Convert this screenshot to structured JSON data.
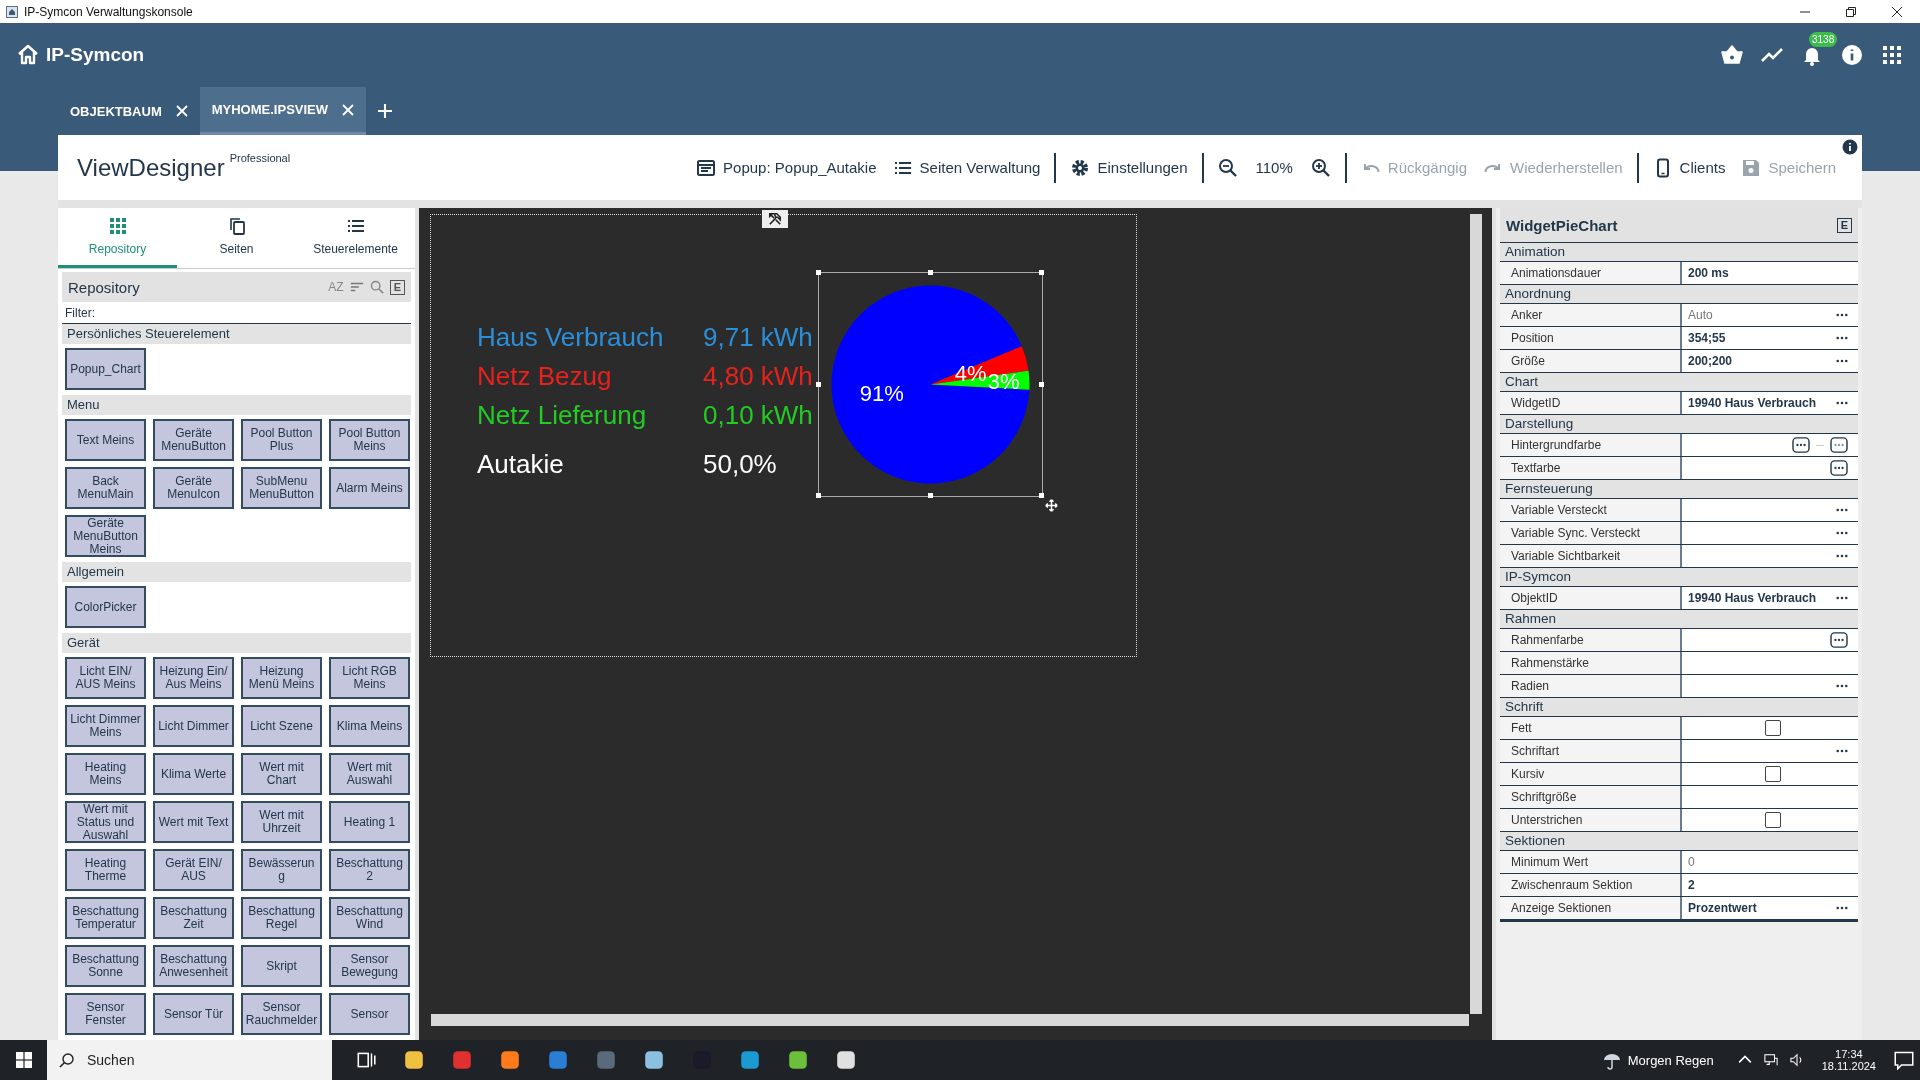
{
  "window": {
    "title": "IP-Symcon Verwaltungskonsole"
  },
  "header": {
    "brand": "IP-Symcon",
    "notification_count": "3138"
  },
  "tabs": [
    {
      "label": "OBJEKTBAUM",
      "selected": false
    },
    {
      "label": "MYHOME.IPSVIEW",
      "selected": true
    }
  ],
  "designer": {
    "title": "ViewDesigner",
    "edition": "Professional"
  },
  "toolbar": [
    {
      "kind": "popup",
      "label": "Popup: Popup_Autakie",
      "disabled": false
    },
    {
      "kind": "pages",
      "label": "Seiten Verwaltung",
      "disabled": false
    },
    {
      "kind": "divider"
    },
    {
      "kind": "settings",
      "label": "Einstellungen",
      "disabled": false
    },
    {
      "kind": "divider"
    },
    {
      "kind": "zoom_out",
      "disabled": false
    },
    {
      "kind": "zoom_level",
      "label": "110%",
      "disabled": false
    },
    {
      "kind": "zoom_in",
      "disabled": false
    },
    {
      "kind": "divider"
    },
    {
      "kind": "undo",
      "label": "Rückgängig",
      "disabled": true
    },
    {
      "kind": "redo",
      "label": "Wiederherstellen",
      "disabled": true
    },
    {
      "kind": "divider"
    },
    {
      "kind": "clients",
      "label": "Clients",
      "disabled": false
    },
    {
      "kind": "save",
      "label": "Speichern",
      "disabled": true
    }
  ],
  "left_tabs": [
    {
      "label": "Repository",
      "selected": true
    },
    {
      "label": "Seiten",
      "selected": false
    },
    {
      "label": "Steuerelemente",
      "selected": false
    }
  ],
  "repository": {
    "title": "Repository",
    "sort_label": "AZ",
    "badge": "E",
    "filter_label": "Filter:",
    "groups": [
      {
        "title": "Persönliches Steuerelement",
        "items": [
          "Popup_Chart"
        ]
      },
      {
        "title": "Menu",
        "items": [
          "Text Meins",
          "Geräte MenuButton",
          "Pool Button Plus",
          "Pool Button Meins",
          "Back MenuMain",
          "Geräte MenuIcon",
          "SubMenu MenuButton",
          "Alarm Meins",
          "Geräte MenuButton Meins"
        ]
      },
      {
        "title": "Allgemein",
        "items": [
          "ColorPicker"
        ]
      },
      {
        "title": "Gerät",
        "items": [
          "Licht EIN/ AUS Meins",
          "Heizung Ein/ Aus Meins",
          "Heizung Menü Meins",
          "Licht RGB Meins",
          "Licht Dimmer Meins",
          "Licht Dimmer",
          "Licht Szene",
          "Klima Meins",
          "Heating Meins",
          "Klima Werte",
          "Wert mit Chart",
          "Wert mit Auswahl",
          "Wert mit Status und Auswahl",
          "Wert mit Text",
          "Wert mit Uhrzeit",
          "Heating 1",
          "Heating Therme",
          "Gerät EIN/ AUS",
          "Bewässerun g",
          "Beschattung 2",
          "Beschattung Temperatur",
          "Beschattung Zeit",
          "Beschattung Regel",
          "Beschattung Wind",
          "Beschattung Sonne",
          "Beschattung Anwesenheit",
          "Skript",
          "Sensor Bewegung",
          "Sensor Fenster",
          "Sensor Tür",
          "Sensor Rauchmelder",
          "Sensor"
        ]
      }
    ]
  },
  "canvas": {
    "readings": [
      {
        "label": "Haus Verbrauch",
        "value": "9,71 kWh",
        "color": "#2b8fd9"
      },
      {
        "label": "Netz Bezug",
        "value": "4,80 kWh",
        "color": "#e8211d"
      },
      {
        "label": "Netz Lieferung",
        "value": "0,10 kWh",
        "color": "#22cc22"
      },
      {
        "label": "Autakie",
        "value": "50,0%",
        "color": "#ffffff"
      }
    ],
    "pie": {
      "selected": true,
      "chart_data": {
        "type": "pie",
        "values": [
          91,
          4,
          3
        ],
        "colors": [
          "#0000ff",
          "#ff0000",
          "#00ff00"
        ],
        "value_labels": [
          "91%",
          "4%",
          "3%"
        ]
      }
    }
  },
  "properties": {
    "title": "WidgetPieChart",
    "badge": "E",
    "groups": [
      {
        "title": "Animation",
        "rows": [
          {
            "label": "Animationsdauer",
            "kind": "text",
            "value": "200 ms",
            "default": false
          }
        ]
      },
      {
        "title": "Anordnung",
        "rows": [
          {
            "label": "Anker",
            "kind": "select",
            "value": "Auto",
            "default": true
          },
          {
            "label": "Position",
            "kind": "select",
            "value": "354;55",
            "default": false
          },
          {
            "label": "Größe",
            "kind": "select",
            "value": "200;200",
            "default": false
          }
        ]
      },
      {
        "title": "Chart",
        "rows": [
          {
            "label": "WidgetID",
            "kind": "select",
            "value": "19940 Haus Verbrauch",
            "default": false
          }
        ]
      },
      {
        "title": "Darstellung",
        "rows": [
          {
            "label": "Hintergrundfarbe",
            "kind": "color_pair"
          },
          {
            "label": "Textfarbe",
            "kind": "color"
          }
        ]
      },
      {
        "title": "Fernsteuerung",
        "rows": [
          {
            "label": "Variable Versteckt",
            "kind": "select"
          },
          {
            "label": "Variable Sync. Versteckt",
            "kind": "select"
          },
          {
            "label": "Variable Sichtbarkeit",
            "kind": "select"
          }
        ]
      },
      {
        "title": "IP-Symcon",
        "rows": [
          {
            "label": "ObjektID",
            "kind": "select",
            "value": "19940 Haus Verbrauch",
            "default": false
          }
        ]
      },
      {
        "title": "Rahmen",
        "rows": [
          {
            "label": "Rahmenfarbe",
            "kind": "color"
          },
          {
            "label": "Rahmenstärke",
            "kind": "text"
          },
          {
            "label": "Radien",
            "kind": "select"
          }
        ]
      },
      {
        "title": "Schrift",
        "rows": [
          {
            "label": "Fett",
            "kind": "checkbox",
            "checked": false
          },
          {
            "label": "Schriftart",
            "kind": "select"
          },
          {
            "label": "Kursiv",
            "kind": "checkbox",
            "checked": false
          },
          {
            "label": "Schriftgröße",
            "kind": "text"
          },
          {
            "label": "Unterstrichen",
            "kind": "checkbox",
            "checked": false
          }
        ]
      },
      {
        "title": "Sektionen",
        "rows": [
          {
            "label": "Minimum Wert",
            "kind": "text",
            "value": "0",
            "default": true
          },
          {
            "label": "Zwischenraum Sektion",
            "kind": "text",
            "value": "2",
            "default": false
          },
          {
            "label": "Anzeige Sektionen",
            "kind": "select",
            "value": "Prozentwert",
            "default": false
          }
        ]
      }
    ]
  },
  "taskbar": {
    "search_placeholder": "Suchen",
    "weather": "Morgen Regen",
    "time": "17:34",
    "date": "18.11.2024"
  }
}
